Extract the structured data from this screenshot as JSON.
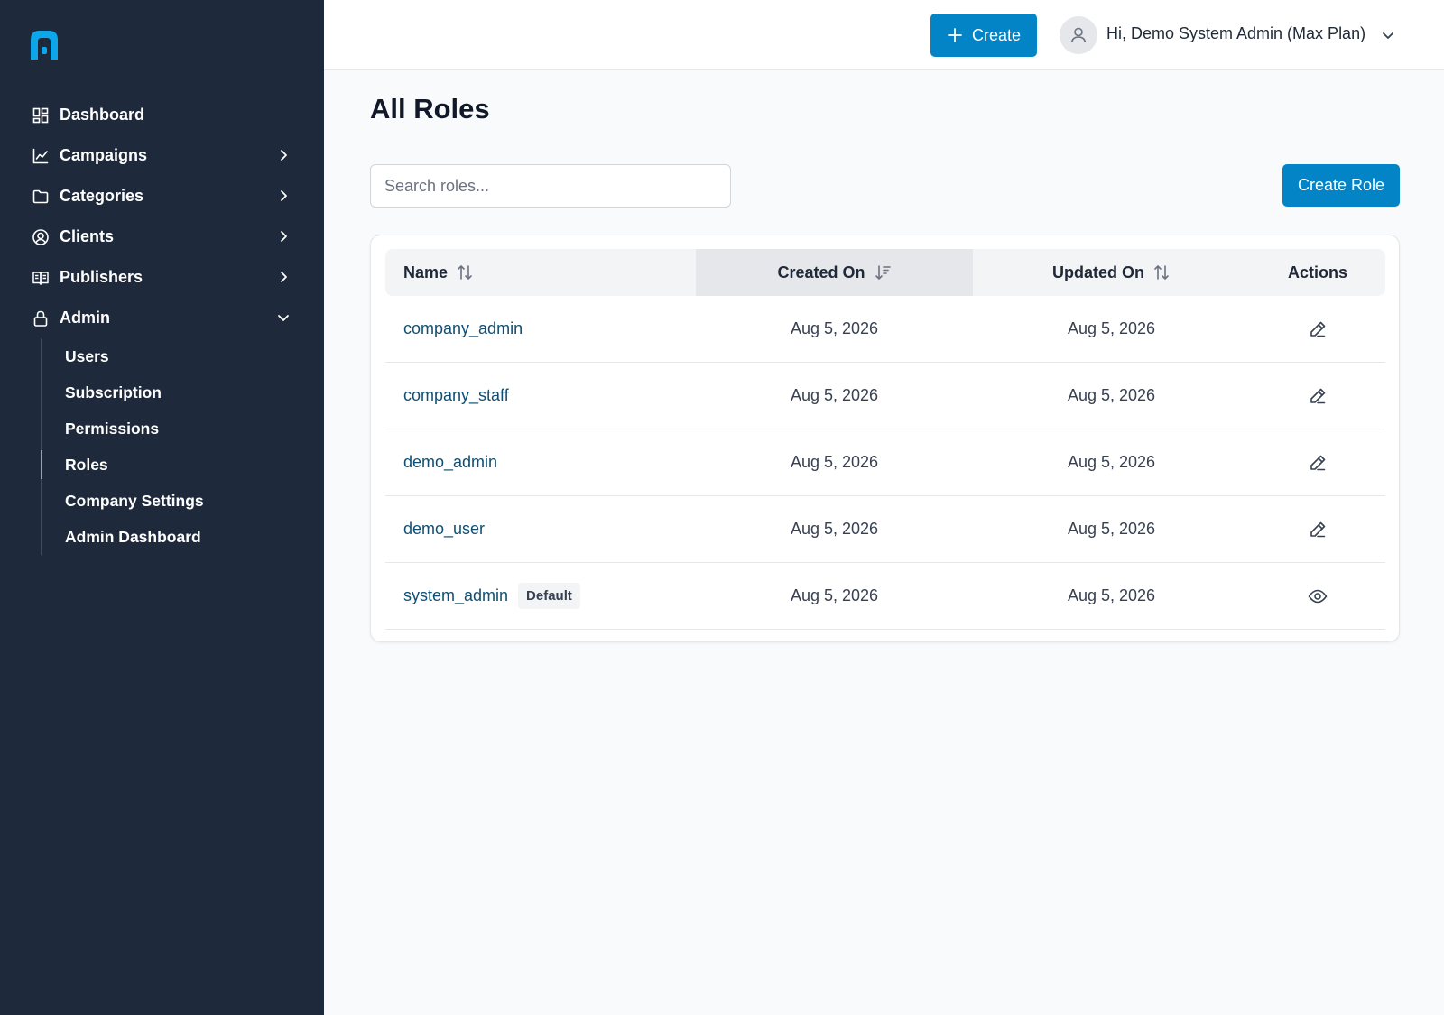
{
  "sidebar": {
    "items": [
      {
        "label": "Dashboard",
        "icon": "dashboard-icon"
      },
      {
        "label": "Campaigns",
        "icon": "chart-line-icon"
      },
      {
        "label": "Categories",
        "icon": "folder-icon"
      },
      {
        "label": "Clients",
        "icon": "user-circle-icon"
      },
      {
        "label": "Publishers",
        "icon": "book-open-icon"
      },
      {
        "label": "Admin",
        "icon": "lock-icon"
      }
    ],
    "admin_subitems": [
      {
        "label": "Users"
      },
      {
        "label": "Subscription"
      },
      {
        "label": "Permissions"
      },
      {
        "label": "Roles",
        "active": true
      },
      {
        "label": "Company Settings"
      },
      {
        "label": "Admin Dashboard"
      }
    ]
  },
  "header": {
    "create_label": "Create",
    "user_greeting": "Hi, Demo System Admin (Max Plan)"
  },
  "main": {
    "title": "All Roles",
    "search_placeholder": "Search roles...",
    "create_role_label": "Create Role",
    "table": {
      "columns": [
        "Name",
        "Created On",
        "Updated On",
        "Actions"
      ],
      "rows": [
        {
          "name": "company_admin",
          "created": "Aug 5, 2026",
          "updated": "Aug 5, 2026",
          "action": "edit-icon"
        },
        {
          "name": "company_staff",
          "created": "Aug 5, 2026",
          "updated": "Aug 5, 2026",
          "action": "edit-icon"
        },
        {
          "name": "demo_admin",
          "created": "Aug 5, 2026",
          "updated": "Aug 5, 2026",
          "action": "edit-icon"
        },
        {
          "name": "demo_user",
          "created": "Aug 5, 2026",
          "updated": "Aug 5, 2026",
          "action": "edit-icon"
        },
        {
          "name": "system_admin",
          "badge": "Default",
          "created": "Aug 5, 2026",
          "updated": "Aug 5, 2026",
          "action": "eye-icon"
        }
      ]
    }
  },
  "colors": {
    "sidebar_bg": "#1e293b",
    "accent": "#0284c7",
    "link": "#0e4f73",
    "page_bg": "#f8fafc"
  }
}
